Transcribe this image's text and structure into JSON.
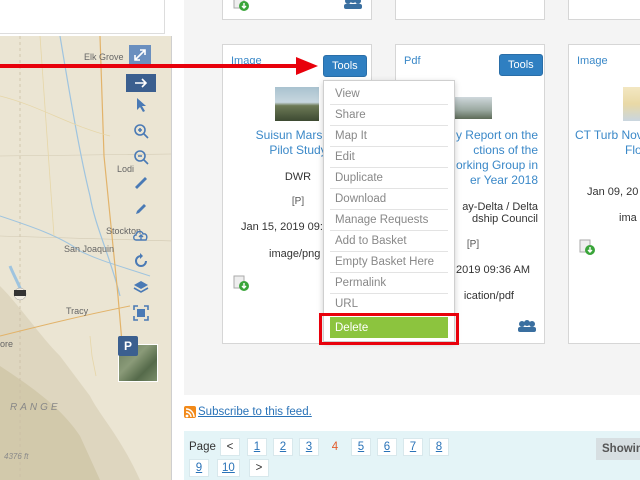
{
  "map": {
    "places": [
      "Elk Grove",
      "Lodi",
      "Stockton",
      "San Joaquin",
      "Tracy",
      "ore"
    ],
    "range_label": "RANGE",
    "elevation": "4376 ft",
    "parking_badge": "P"
  },
  "cards": [
    {
      "type": "Image",
      "tools_label": "Tools",
      "title_lines": [
        "Suisun Marsh S",
        "Pilot Study"
      ],
      "agency": "DWR",
      "access": "[P]",
      "date": "Jan 15, 2019 09:4",
      "format": "image/png"
    },
    {
      "type": "Pdf",
      "tools_label": "Tools",
      "title_lines": [
        "y Report on the",
        "ctions of the",
        "orking Group in",
        "er Year 2018"
      ],
      "agency_lines": [
        "ay-Delta / Delta",
        "dship Council"
      ],
      "access": "[P]",
      "date": "2019 09:36 AM",
      "format": "ication/pdf"
    },
    {
      "type": "Image",
      "title_lines": [
        "CT Turb Nov",
        "Floo"
      ],
      "date": "Jan 09, 20",
      "format": "ima"
    }
  ],
  "menu": {
    "items": [
      "View",
      "Share",
      "Map It",
      "Edit",
      "Duplicate",
      "Download",
      "Manage Requests",
      "Add to Basket",
      "Empty Basket Here",
      "Permalink",
      "URL"
    ],
    "delete_label": "Delete"
  },
  "feed": {
    "subscribe_label": "Subscribe to this feed."
  },
  "pagination": {
    "label": "Page",
    "prev": "<",
    "next": ">",
    "pages": [
      "1",
      "2",
      "3",
      "4",
      "5",
      "6",
      "7",
      "8",
      "9",
      "10"
    ],
    "current": "4",
    "showing_label": "Showing"
  },
  "colors": {
    "accent": "#2f7fc1",
    "delete": "#8cc43e",
    "highlight": "#e8000b",
    "link": "#3a88c8"
  }
}
